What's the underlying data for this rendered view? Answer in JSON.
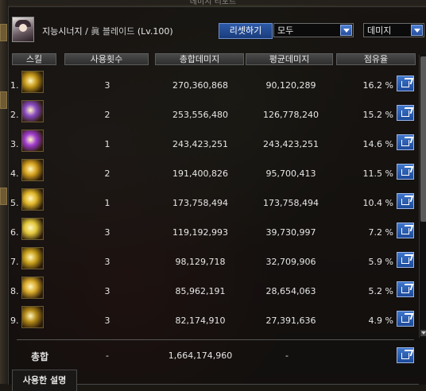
{
  "window": {
    "title": "데미지 리포트"
  },
  "header": {
    "character_name": "지능시너지",
    "separator": "/",
    "job_prefix": "眞",
    "job_name": "블레이드",
    "level_text": "(Lv.100)",
    "reset_label": "리셋하기",
    "filter_party": {
      "selected": "모두"
    },
    "filter_metric": {
      "selected": "데미지"
    }
  },
  "columns": {
    "skill": "스킬",
    "use_count": "사용횟수",
    "total_damage": "총합데미지",
    "avg_damage": "평균데미지",
    "share": "점유율"
  },
  "rows": [
    {
      "rank": "1.",
      "count": "3",
      "total": "270,360,868",
      "avg": "90,120,289",
      "pct": "16.2 %",
      "icon_color": "#c79a1a"
    },
    {
      "rank": "2.",
      "count": "2",
      "total": "253,556,480",
      "avg": "126,778,240",
      "pct": "15.2 %",
      "icon_color": "#8a4ac4"
    },
    {
      "rank": "3.",
      "count": "1",
      "total": "243,423,251",
      "avg": "243,423,251",
      "pct": "14.6 %",
      "icon_color": "#a03bd0"
    },
    {
      "rank": "4.",
      "count": "2",
      "total": "191,400,826",
      "avg": "95,700,413",
      "pct": "11.5 %",
      "icon_color": "#d6a21e"
    },
    {
      "rank": "5.",
      "count": "1",
      "total": "173,758,494",
      "avg": "173,758,494",
      "pct": "10.4 %",
      "icon_color": "#e0b628"
    },
    {
      "rank": "6.",
      "count": "3",
      "total": "119,192,993",
      "avg": "39,730,997",
      "pct": "7.2 %",
      "icon_color": "#e2c63a"
    },
    {
      "rank": "7.",
      "count": "3",
      "total": "98,129,718",
      "avg": "32,709,906",
      "pct": "5.9 %",
      "icon_color": "#cba21c"
    },
    {
      "rank": "8.",
      "count": "3",
      "total": "85,962,191",
      "avg": "28,654,063",
      "pct": "5.2 %",
      "icon_color": "#d9aa2a"
    },
    {
      "rank": "9.",
      "count": "3",
      "total": "82,174,910",
      "avg": "27,391,636",
      "pct": "4.9 %",
      "icon_color": "#b48a18"
    }
  ],
  "total": {
    "label": "총합",
    "count": "-",
    "total": "1,664,174,960",
    "avg": "-"
  },
  "tabs": {
    "description": "사용한 설명"
  }
}
